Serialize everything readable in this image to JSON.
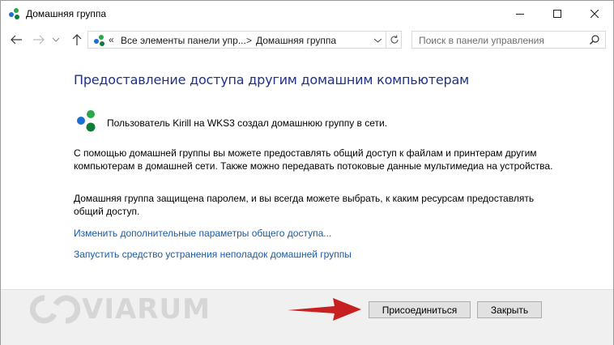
{
  "window": {
    "title": "Домашняя группа"
  },
  "address": {
    "chevrons": "«",
    "crumb1": "Все элементы панели упр...",
    "separator": ">",
    "crumb2": "Домашняя группа"
  },
  "search": {
    "placeholder": "Поиск в панели управления"
  },
  "content": {
    "heading": "Предоставление доступа другим домашним компьютерам",
    "note": "Пользователь Kirill на WKS3 создал домашнюю группу в сети.",
    "paragraph1": "С помощью домашней группы вы можете предоставлять общий доступ к файлам и принтерам другим компьютерам в домашней сети. Также можно передавать потоковые данные мультимедиа на устройства.",
    "paragraph2": "Домашняя группа защищена паролем, и вы всегда можете выбрать, к каким ресурсам предоставлять общий доступ.",
    "link1": "Изменить дополнительные параметры общего доступа...",
    "link2": "Запустить средство устранения неполадок домашней группы"
  },
  "footer": {
    "join_label": "Присоединиться",
    "close_label": "Закрыть",
    "watermark": "VIARUM"
  },
  "colors": {
    "heading": "#1e3287",
    "link": "#1e5aa5",
    "arrow": "#c82020"
  }
}
